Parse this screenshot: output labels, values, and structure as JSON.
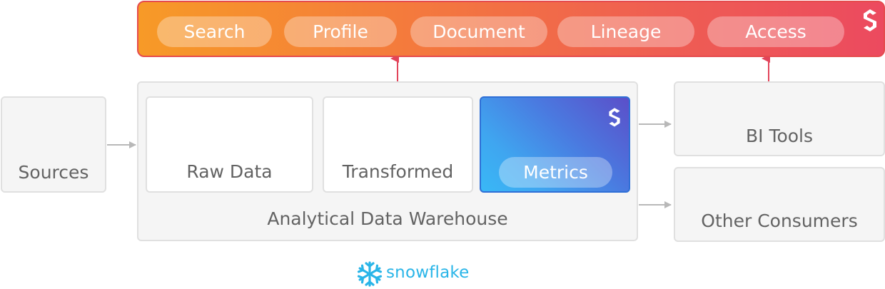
{
  "top_bar": {
    "items": [
      "Search",
      "Profile",
      "Document",
      "Lineage",
      "Access"
    ]
  },
  "sources": {
    "label": "Sources"
  },
  "warehouse": {
    "label": "Analytical Data Warehouse",
    "stages": [
      "Raw Data",
      "Transformed",
      "Metrics"
    ]
  },
  "consumers": {
    "bi_tools": "BI Tools",
    "other": "Other Consumers"
  },
  "brand": {
    "snowflake_text": "snowflake",
    "snowflake_color": "#29b5e8",
    "bar_gradient": [
      "#f79a27",
      "#ec4a5f"
    ],
    "metrics_gradient": [
      "#39b8f6",
      "#5b4fc9"
    ],
    "arrow_color": "#e2445a",
    "connector_color": "#b8b8b8"
  }
}
